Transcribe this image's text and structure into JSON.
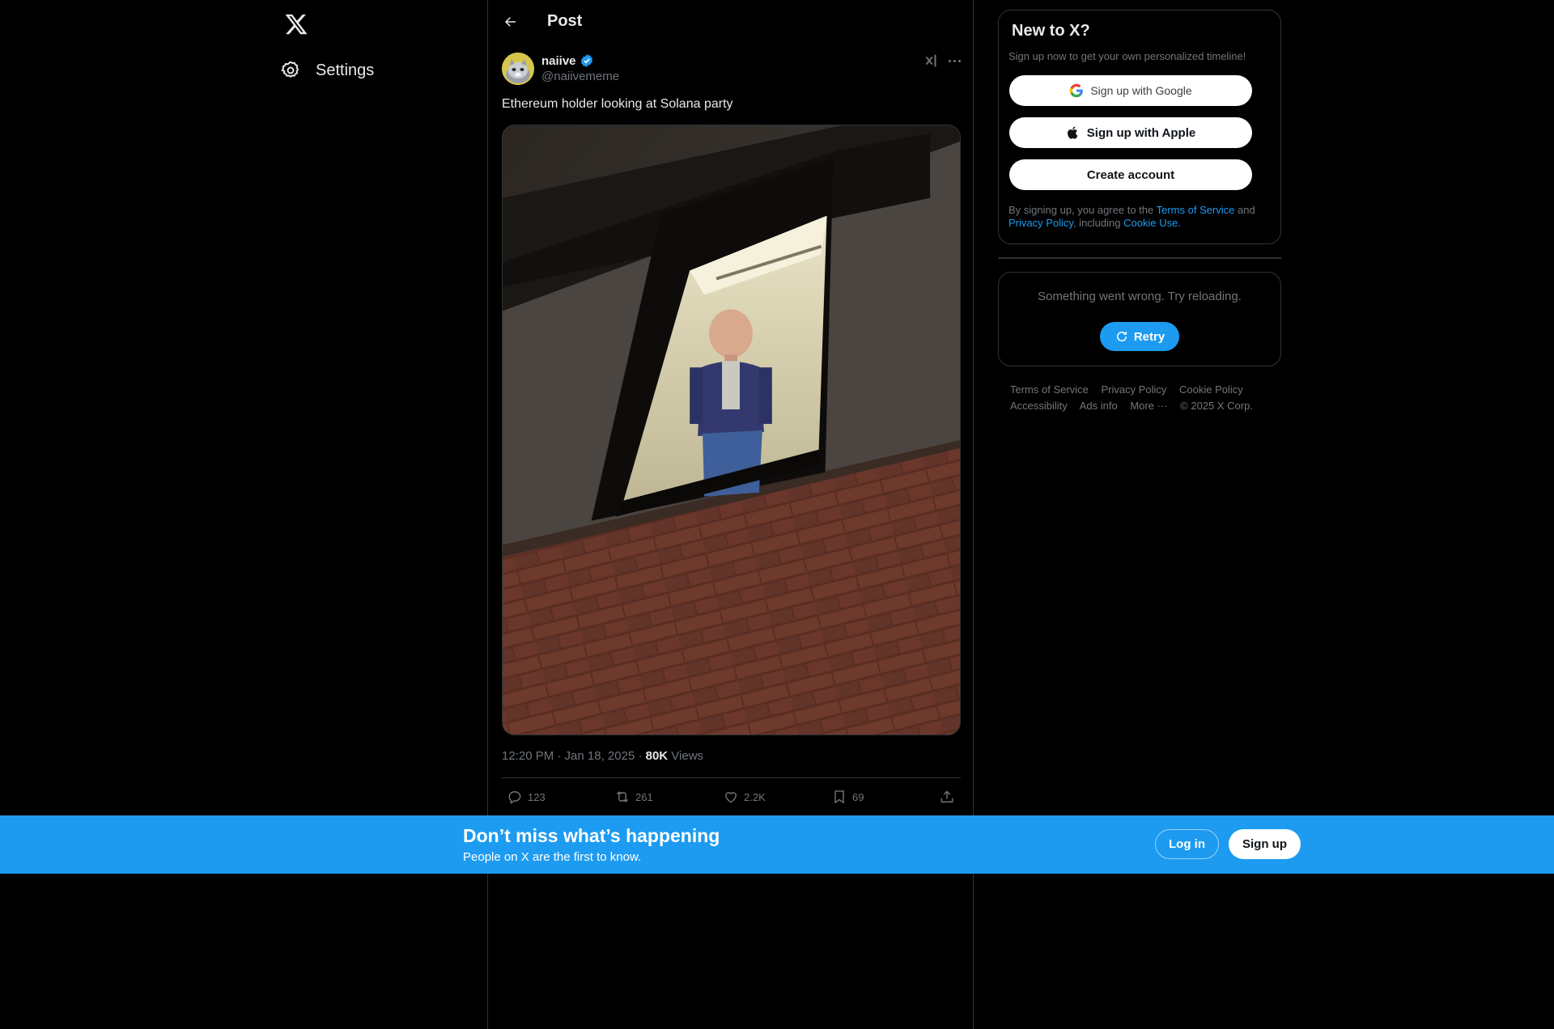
{
  "nav": {
    "settings_label": "Settings"
  },
  "header": {
    "title": "Post"
  },
  "post": {
    "author_name": "naiive",
    "author_handle": "@naiivememe",
    "text": "Ethereum holder looking at Solana party",
    "time": "12:20 PM · Jan 18, 2025 · ",
    "views_count": "80K",
    "views_label": " Views",
    "replies": "123",
    "reposts": "261",
    "likes": "2.2K",
    "bookmarks": "69"
  },
  "signup": {
    "title": "New to X?",
    "subtitle": "Sign up now to get your own personalized timeline!",
    "google_label": "Sign up with Google",
    "apple_label": "Sign up with Apple",
    "create_label": "Create account",
    "legal_prefix": "By signing up, you agree to the ",
    "terms_link": "Terms of Service",
    "legal_and": " and ",
    "privacy_link": "Privacy Policy",
    "legal_including": ", including ",
    "cookie_link": "Cookie Use."
  },
  "error": {
    "message": "Something went wrong. Try reloading.",
    "retry_label": "Retry"
  },
  "footer": {
    "terms": "Terms of Service",
    "privacy": "Privacy Policy",
    "cookie": "Cookie Policy",
    "accessibility": "Accessibility",
    "ads": "Ads info",
    "more": "More ···",
    "copyright": "© 2025 X Corp."
  },
  "banner": {
    "title": "Don’t miss what’s happening",
    "subtitle": "People on X are the first to know.",
    "login_label": "Log in",
    "signup_label": "Sign up"
  },
  "colors": {
    "accent": "#1d9bf0",
    "background": "#000000",
    "border": "#2f3336",
    "muted_text": "#71767b"
  },
  "icons": {
    "logo": "x-logo-icon",
    "settings": "gear-icon",
    "back": "arrow-left-icon",
    "verified": "verified-badge-icon",
    "grok": "grok-icon",
    "more": "more-dots-icon",
    "reply": "reply-icon",
    "repost": "repost-icon",
    "like": "heart-icon",
    "bookmark": "bookmark-icon",
    "share": "share-icon",
    "google": "google-icon",
    "apple": "apple-icon",
    "retry": "refresh-icon"
  }
}
